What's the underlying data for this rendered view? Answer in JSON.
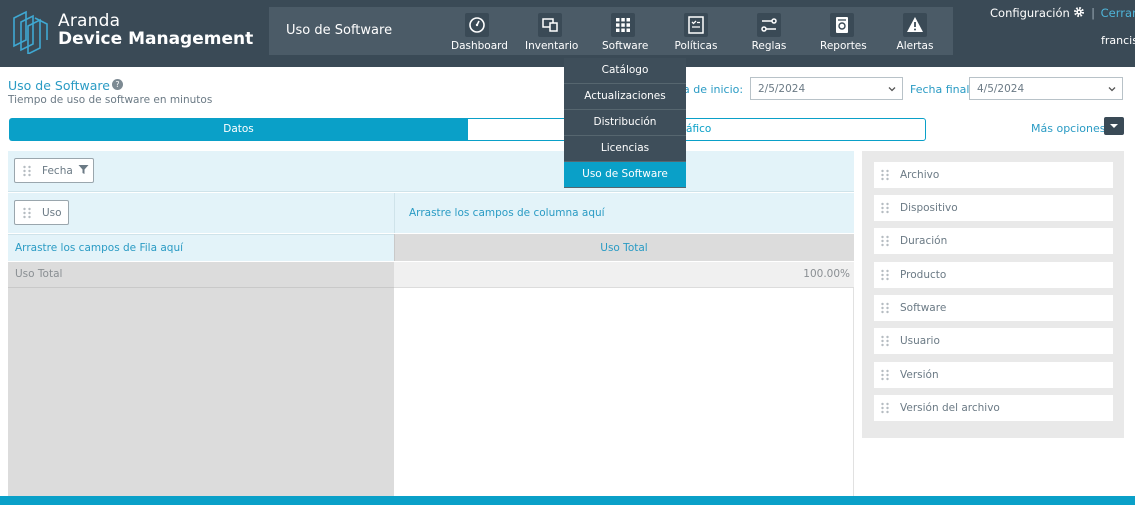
{
  "brand": {
    "line1": "Aranda",
    "line2": "Device Management"
  },
  "nav": {
    "section_title": "Uso de Software",
    "items": [
      {
        "label": "Dashboard",
        "icon": "gauge-icon"
      },
      {
        "label": "Inventario",
        "icon": "devices-icon"
      },
      {
        "label": "Software",
        "icon": "grid-icon"
      },
      {
        "label": "Políticas",
        "icon": "checklist-icon"
      },
      {
        "label": "Reglas",
        "icon": "rules-icon"
      },
      {
        "label": "Reportes",
        "icon": "report-icon"
      },
      {
        "label": "Alertas",
        "icon": "warning-icon"
      }
    ]
  },
  "header": {
    "config": "Configuración",
    "logout": "Cerrar sesió",
    "separator": "|",
    "user": "francisc"
  },
  "page": {
    "title": "Uso de Software",
    "subtitle": "Tiempo de uso de software en minutos",
    "help": "?"
  },
  "filters": {
    "start_label": "ha de inicio:",
    "start_value": "2/5/2024",
    "end_label": "Fecha final:",
    "end_value": "4/5/2024"
  },
  "tabs": {
    "datos": "Datos",
    "grafico": "ráfico"
  },
  "more_options": "Más opciones:",
  "pivot": {
    "filter_chip": "Fecha",
    "row_chip": "Uso",
    "column_hint": "Arrastre los campos de columna aquí",
    "row_hint": "Arrastre los campos de Fila aquí",
    "column_header": "Uso Total",
    "row_label": "Uso Total",
    "value": "100.00%"
  },
  "fields": [
    "Archivo",
    "Dispositivo",
    "Duración",
    "Producto",
    "Software",
    "Usuario",
    "Versión",
    "Versión del archivo"
  ],
  "dropdown": {
    "items": [
      "Catálogo",
      "Actualizaciones",
      "Distribución",
      "Licencias",
      "Uso de Software"
    ],
    "active_index": 4
  },
  "colors": {
    "topbar": "#3a4a56",
    "accent": "#0aa0c8",
    "link": "#2a9bc4"
  }
}
